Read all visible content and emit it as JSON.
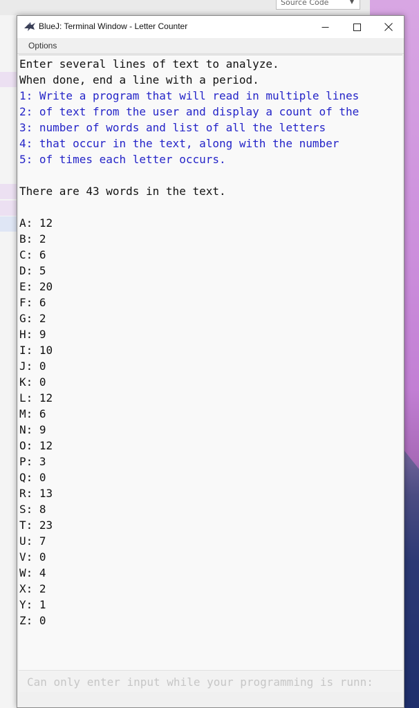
{
  "background": {
    "dropdown_label": "Source Code"
  },
  "window": {
    "title": "BlueJ: Terminal Window - Letter Counter",
    "menu_options": "Options",
    "buttons": {
      "minimize_symbol": "—",
      "maximize_symbol": "☐",
      "close_symbol": "✕"
    }
  },
  "terminal": {
    "lines": [
      {
        "text": "Enter several lines of text to analyze.",
        "kind": "output"
      },
      {
        "text": "When done, end a line with a period.",
        "kind": "output"
      },
      {
        "text": "1: Write a program that will read in multiple lines",
        "kind": "input"
      },
      {
        "text": "2: of text from the user and display a count of the",
        "kind": "input"
      },
      {
        "text": "3: number of words and list of all the letters",
        "kind": "input"
      },
      {
        "text": "4: that occur in the text, along with the number",
        "kind": "input"
      },
      {
        "text": "5: of times each letter occurs.",
        "kind": "input"
      },
      {
        "text": "",
        "kind": "output"
      },
      {
        "text": "There are 43 words in the text.",
        "kind": "output"
      },
      {
        "text": "",
        "kind": "output"
      },
      {
        "text": "A: 12",
        "kind": "output"
      },
      {
        "text": "B: 2",
        "kind": "output"
      },
      {
        "text": "C: 6",
        "kind": "output"
      },
      {
        "text": "D: 5",
        "kind": "output"
      },
      {
        "text": "E: 20",
        "kind": "output"
      },
      {
        "text": "F: 6",
        "kind": "output"
      },
      {
        "text": "G: 2",
        "kind": "output"
      },
      {
        "text": "H: 9",
        "kind": "output"
      },
      {
        "text": "I: 10",
        "kind": "output"
      },
      {
        "text": "J: 0",
        "kind": "output"
      },
      {
        "text": "K: 0",
        "kind": "output"
      },
      {
        "text": "L: 12",
        "kind": "output"
      },
      {
        "text": "M: 6",
        "kind": "output"
      },
      {
        "text": "N: 9",
        "kind": "output"
      },
      {
        "text": "O: 12",
        "kind": "output"
      },
      {
        "text": "P: 3",
        "kind": "output"
      },
      {
        "text": "Q: 0",
        "kind": "output"
      },
      {
        "text": "R: 13",
        "kind": "output"
      },
      {
        "text": "S: 8",
        "kind": "output"
      },
      {
        "text": "T: 23",
        "kind": "output"
      },
      {
        "text": "U: 7",
        "kind": "output"
      },
      {
        "text": "V: 0",
        "kind": "output"
      },
      {
        "text": "W: 4",
        "kind": "output"
      },
      {
        "text": "X: 2",
        "kind": "output"
      },
      {
        "text": "Y: 1",
        "kind": "output"
      },
      {
        "text": "Z: 0",
        "kind": "output"
      }
    ],
    "input_value": "",
    "input_placeholder": "Can only enter input while your programming is runn:"
  },
  "colors": {
    "input_text": "#2424c8",
    "output_text": "#111111"
  }
}
